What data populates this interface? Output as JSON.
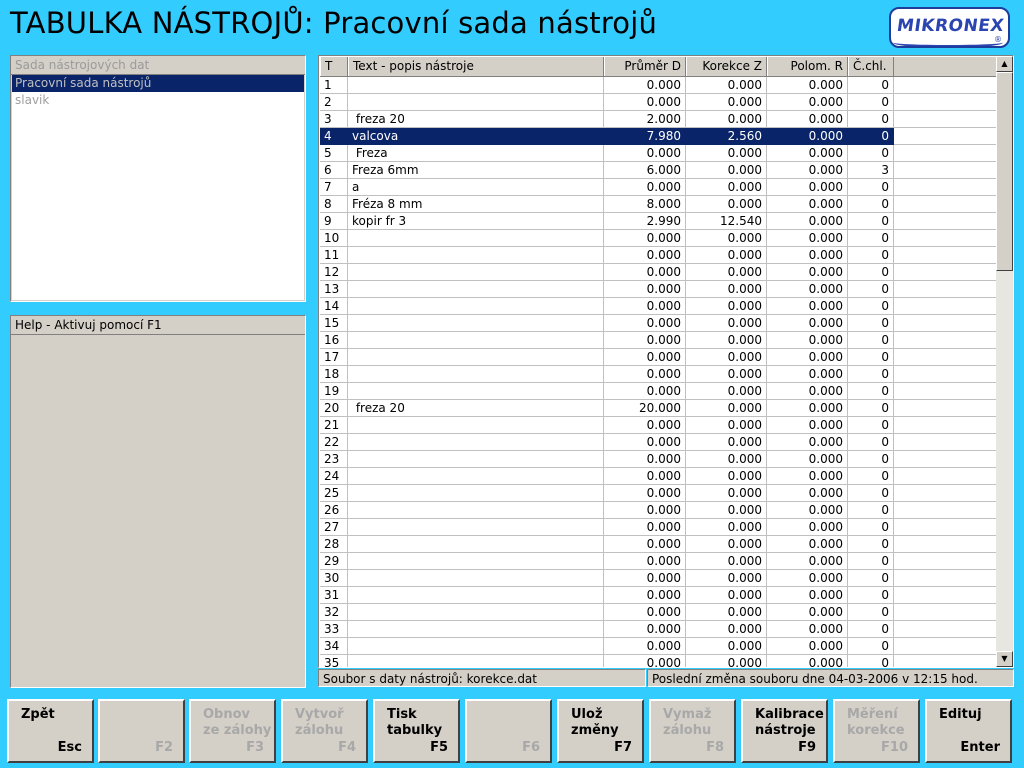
{
  "window": {
    "title": "TABULKA NÁSTROJŮ: Pracovní sada nástrojů",
    "logo": "MIKRONEX",
    "logo_mark": "®"
  },
  "sets_panel": {
    "header": "Sada nástrojových dat",
    "items": [
      {
        "label": "Pracovní sada nástrojů",
        "selected": true
      },
      {
        "label": "slavik",
        "selected": false
      }
    ]
  },
  "help_panel": {
    "header": "Help - Aktivuj pomocí F1"
  },
  "table": {
    "columns": [
      "T",
      "Text - popis nástroje",
      "Průměr D",
      "Korekce Z",
      "Polom. R",
      "Č.chl."
    ],
    "selected_row": 4,
    "rows": [
      [
        "1",
        "",
        "0.000",
        "0.000",
        "0.000",
        "0"
      ],
      [
        "2",
        "",
        "0.000",
        "0.000",
        "0.000",
        "0"
      ],
      [
        "3",
        " freza 20",
        "2.000",
        "0.000",
        "0.000",
        "0"
      ],
      [
        "4",
        "valcova",
        "7.980",
        "2.560",
        "0.000",
        "0"
      ],
      [
        "5",
        " Freza",
        "0.000",
        "0.000",
        "0.000",
        "0"
      ],
      [
        "6",
        "Freza 6mm",
        "6.000",
        "0.000",
        "0.000",
        "3"
      ],
      [
        "7",
        "a",
        "0.000",
        "0.000",
        "0.000",
        "0"
      ],
      [
        "8",
        "Fréza 8 mm",
        "8.000",
        "0.000",
        "0.000",
        "0"
      ],
      [
        "9",
        "kopir fr 3",
        "2.990",
        "12.540",
        "0.000",
        "0"
      ],
      [
        "10",
        "",
        "0.000",
        "0.000",
        "0.000",
        "0"
      ],
      [
        "11",
        "",
        "0.000",
        "0.000",
        "0.000",
        "0"
      ],
      [
        "12",
        "",
        "0.000",
        "0.000",
        "0.000",
        "0"
      ],
      [
        "13",
        "",
        "0.000",
        "0.000",
        "0.000",
        "0"
      ],
      [
        "14",
        "",
        "0.000",
        "0.000",
        "0.000",
        "0"
      ],
      [
        "15",
        "",
        "0.000",
        "0.000",
        "0.000",
        "0"
      ],
      [
        "16",
        "",
        "0.000",
        "0.000",
        "0.000",
        "0"
      ],
      [
        "17",
        "",
        "0.000",
        "0.000",
        "0.000",
        "0"
      ],
      [
        "18",
        "",
        "0.000",
        "0.000",
        "0.000",
        "0"
      ],
      [
        "19",
        "",
        "0.000",
        "0.000",
        "0.000",
        "0"
      ],
      [
        "20",
        " freza 20",
        "20.000",
        "0.000",
        "0.000",
        "0"
      ],
      [
        "21",
        "",
        "0.000",
        "0.000",
        "0.000",
        "0"
      ],
      [
        "22",
        "",
        "0.000",
        "0.000",
        "0.000",
        "0"
      ],
      [
        "23",
        "",
        "0.000",
        "0.000",
        "0.000",
        "0"
      ],
      [
        "24",
        "",
        "0.000",
        "0.000",
        "0.000",
        "0"
      ],
      [
        "25",
        "",
        "0.000",
        "0.000",
        "0.000",
        "0"
      ],
      [
        "26",
        "",
        "0.000",
        "0.000",
        "0.000",
        "0"
      ],
      [
        "27",
        "",
        "0.000",
        "0.000",
        "0.000",
        "0"
      ],
      [
        "28",
        "",
        "0.000",
        "0.000",
        "0.000",
        "0"
      ],
      [
        "29",
        "",
        "0.000",
        "0.000",
        "0.000",
        "0"
      ],
      [
        "30",
        "",
        "0.000",
        "0.000",
        "0.000",
        "0"
      ],
      [
        "31",
        "",
        "0.000",
        "0.000",
        "0.000",
        "0"
      ],
      [
        "32",
        "",
        "0.000",
        "0.000",
        "0.000",
        "0"
      ],
      [
        "33",
        "",
        "0.000",
        "0.000",
        "0.000",
        "0"
      ],
      [
        "34",
        "",
        "0.000",
        "0.000",
        "0.000",
        "0"
      ],
      [
        "35",
        "",
        "0.000",
        "0.000",
        "0.000",
        "0"
      ]
    ]
  },
  "status": {
    "file_label": "Soubor s daty nástrojů:   korekce.dat",
    "last_change": "Poslední změna souboru dne 04-03-2006 v 12:15 hod."
  },
  "scrollbar": {
    "up_icon": "▲",
    "down_icon": "▼"
  },
  "function_keys": [
    {
      "label": "Zpět",
      "key": "Esc",
      "enabled": true
    },
    {
      "label": "",
      "key": "F2",
      "enabled": false
    },
    {
      "label": "Obnov\nze zálohy",
      "key": "F3",
      "enabled": false
    },
    {
      "label": "Vytvoř\nzálohu",
      "key": "F4",
      "enabled": false
    },
    {
      "label": "Tisk\ntabulky",
      "key": "F5",
      "enabled": true
    },
    {
      "label": "",
      "key": "F6",
      "enabled": false
    },
    {
      "label": "Ulož\nzměny",
      "key": "F7",
      "enabled": true
    },
    {
      "label": "Vymaž\nzálohu",
      "key": "F8",
      "enabled": false
    },
    {
      "label": "Kalibrace\nnástroje",
      "key": "F9",
      "enabled": true
    },
    {
      "label": "Měření\nkorekce",
      "key": "F10",
      "enabled": false
    },
    {
      "label": "Edituj",
      "key": "Enter",
      "enabled": true
    }
  ]
}
